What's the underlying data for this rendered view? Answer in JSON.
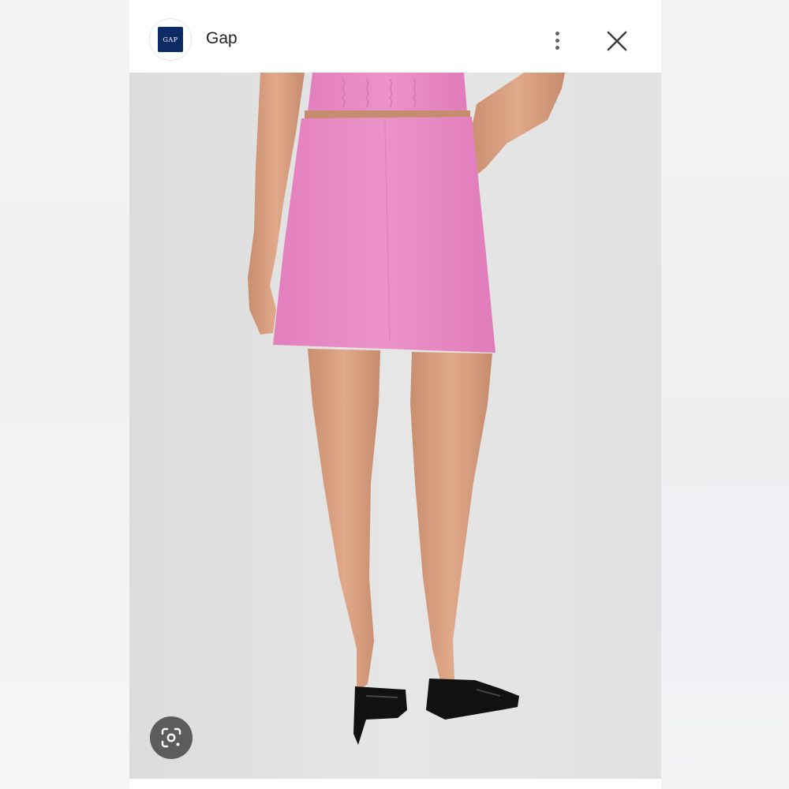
{
  "header": {
    "site_name": "Gap",
    "logo_text": "GAP",
    "logo_color": "#0c2a63"
  },
  "icons": {
    "more": "more-vert-icon",
    "close": "close-icon",
    "lens": "google-lens-icon"
  },
  "colors": {
    "skirt": "#e989c4",
    "background": "#e4e4e4",
    "shoe": "#111111"
  }
}
